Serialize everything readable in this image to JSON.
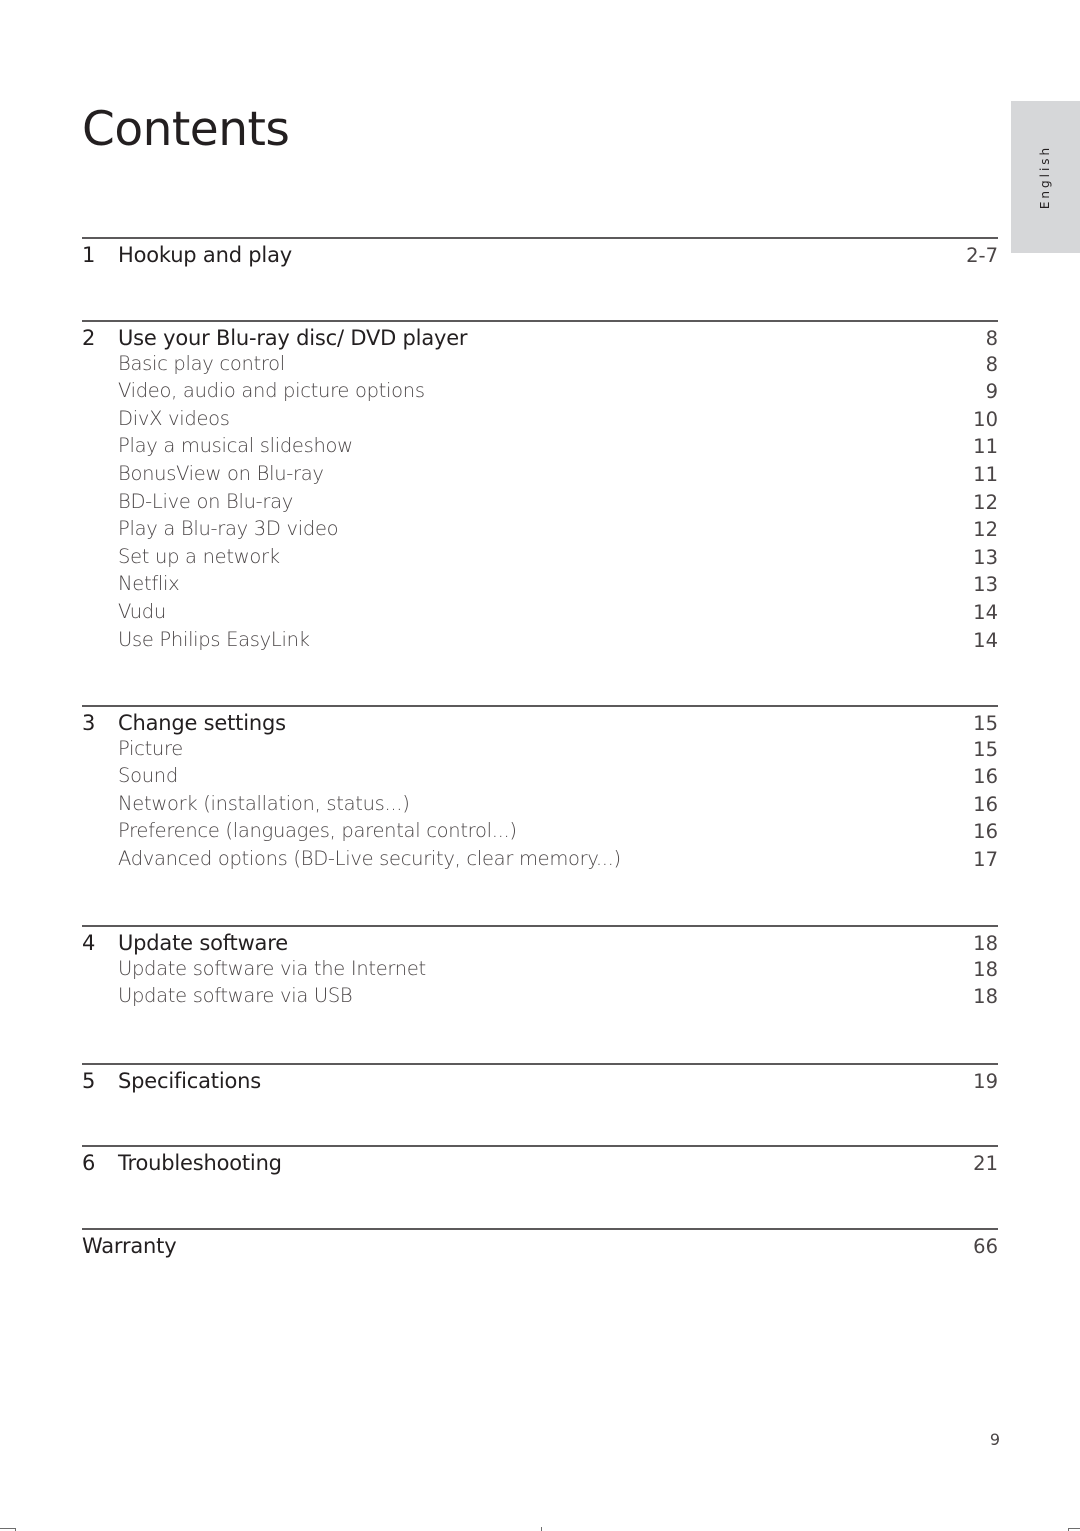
{
  "page": {
    "title": "Contents",
    "language_tab": "English",
    "page_number": "9"
  },
  "toc": [
    {
      "number": "1",
      "title": "Hookup and play",
      "page": "2-7",
      "items": []
    },
    {
      "number": "2",
      "title": "Use your Blu-ray disc/ DVD player",
      "page": "8",
      "items": [
        {
          "label": "Basic play control",
          "page": "8"
        },
        {
          "label": "Video, audio and picture options",
          "page": "9"
        },
        {
          "label": "DivX videos",
          "page": "10"
        },
        {
          "label": "Play a musical slideshow",
          "page": "11"
        },
        {
          "label": "BonusView on Blu-ray",
          "page": "11"
        },
        {
          "label": "BD-Live on Blu-ray",
          "page": "12"
        },
        {
          "label": "Play a Blu-ray 3D video",
          "page": "12"
        },
        {
          "label": "Set up a network",
          "page": "13"
        },
        {
          "label": "Netflix",
          "page": "13"
        },
        {
          "label": "Vudu",
          "page": "14"
        },
        {
          "label": "Use Philips EasyLink",
          "page": "14"
        }
      ]
    },
    {
      "number": "3",
      "title": "Change settings",
      "page": "15",
      "items": [
        {
          "label": "Picture",
          "page": "15"
        },
        {
          "label": "Sound",
          "page": "16"
        },
        {
          "label": "Network (installation, status...)",
          "page": "16"
        },
        {
          "label": "Preference (languages, parental control...)",
          "page": "16"
        },
        {
          "label": "Advanced options (BD-Live security, clear memory...)",
          "page": "17"
        }
      ]
    },
    {
      "number": "4",
      "title": "Update software",
      "page": "18",
      "items": [
        {
          "label": "Update software via the Internet",
          "page": "18"
        },
        {
          "label": "Update software via USB",
          "page": "18"
        }
      ]
    },
    {
      "number": "5",
      "title": "Specifications",
      "page": "19",
      "items": []
    },
    {
      "number": "6",
      "title": "Troubleshooting",
      "page": "21",
      "items": []
    },
    {
      "number": "",
      "title": "Warranty",
      "page": "66",
      "items": []
    }
  ]
}
